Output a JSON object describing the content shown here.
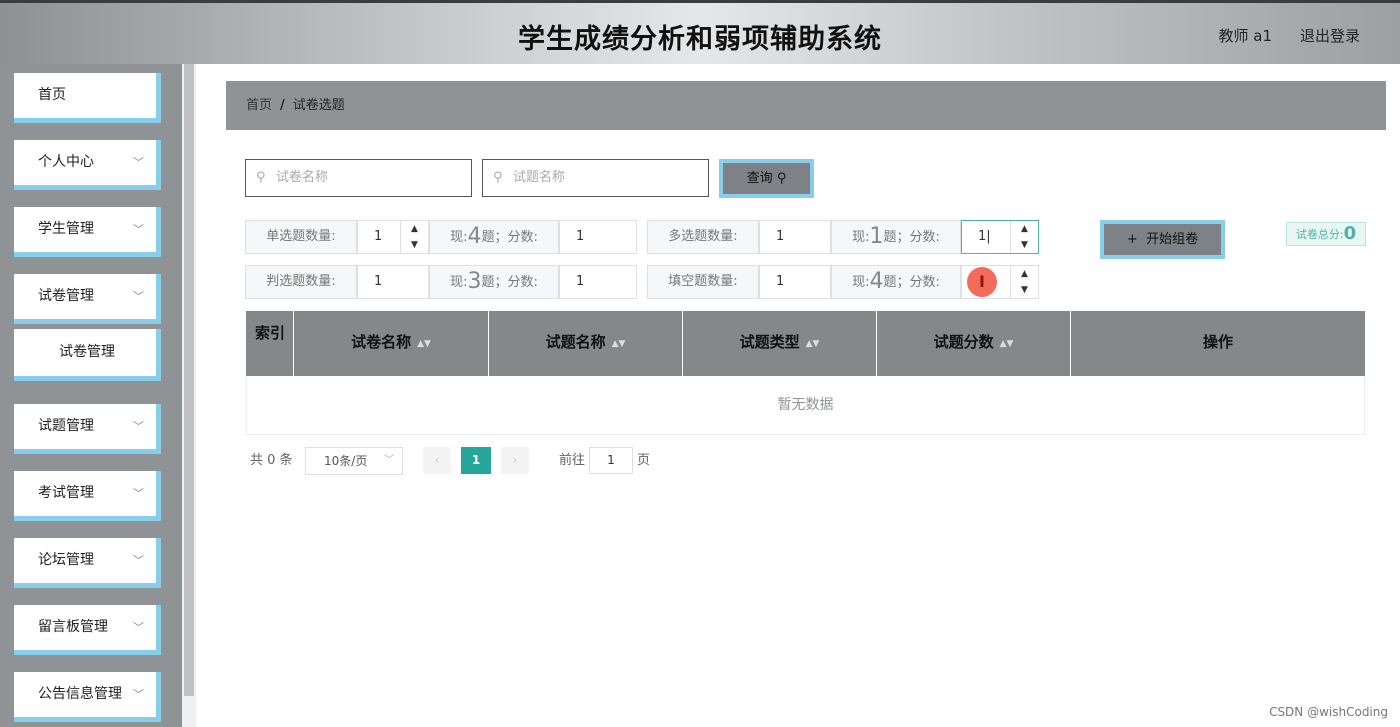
{
  "header": {
    "title": "学生成绩分析和弱项辅助系统",
    "user": "教师 a1",
    "logout": "退出登录"
  },
  "sidebar": {
    "items": [
      {
        "label": "首页",
        "has_chevron": false
      },
      {
        "label": "个人中心",
        "has_chevron": true
      },
      {
        "label": "学生管理",
        "has_chevron": true
      },
      {
        "label": "试卷管理",
        "has_chevron": true,
        "expanded": true
      },
      {
        "label": "试题管理",
        "has_chevron": true
      },
      {
        "label": "考试管理",
        "has_chevron": true
      },
      {
        "label": "论坛管理",
        "has_chevron": true
      },
      {
        "label": "留言板管理",
        "has_chevron": true
      },
      {
        "label": "公告信息管理",
        "has_chevron": true
      }
    ],
    "submenu": {
      "label": "试卷管理"
    },
    "chevron_glyph": "﹀"
  },
  "breadcrumb": {
    "home": "首页",
    "separator": "/",
    "current": "试卷选题"
  },
  "search": {
    "paper_placeholder": "试卷名称",
    "question_placeholder": "试题名称",
    "query_label": "查询"
  },
  "config": {
    "single": {
      "label": "单选题数量:",
      "count": "1",
      "now_prefix": "现:",
      "now_value": "4",
      "now_suffix": "题；分数:",
      "score": "1"
    },
    "multi": {
      "label": "多选题数量:",
      "count": "1",
      "now_prefix": "现:",
      "now_value": "1",
      "now_suffix": "题；分数:",
      "score": "1|"
    },
    "judge": {
      "label": "判选题数量:",
      "count": "1",
      "now_prefix": "现:",
      "now_value": "3",
      "now_suffix": "题；分数:",
      "score": "1"
    },
    "fill": {
      "label": "填空题数量:",
      "count": "1",
      "now_prefix": "现:",
      "now_value": "4",
      "now_suffix": "题；分数:",
      "score": ""
    }
  },
  "actions": {
    "start_label": "开始组卷",
    "total_label": "试卷总分:",
    "total_value": "0"
  },
  "table": {
    "columns": [
      "索引",
      "试卷名称",
      "试题名称",
      "试题类型",
      "试题分数",
      "操作"
    ],
    "empty_text": "暂无数据"
  },
  "pagination": {
    "total": "共 0 条",
    "page_size": "10条/页",
    "prev": "‹",
    "current_page": "1",
    "next": "›",
    "goto_label": "前往",
    "goto_value": "1",
    "page_suffix": "页"
  },
  "cursor_glyph": "I",
  "watermark": "CSDN @wishCoding",
  "colors": {
    "accent": "#87ceeb",
    "primary": "#26a69a",
    "sidebar_bg": "#909396",
    "table_header_bg": "#84888b"
  }
}
